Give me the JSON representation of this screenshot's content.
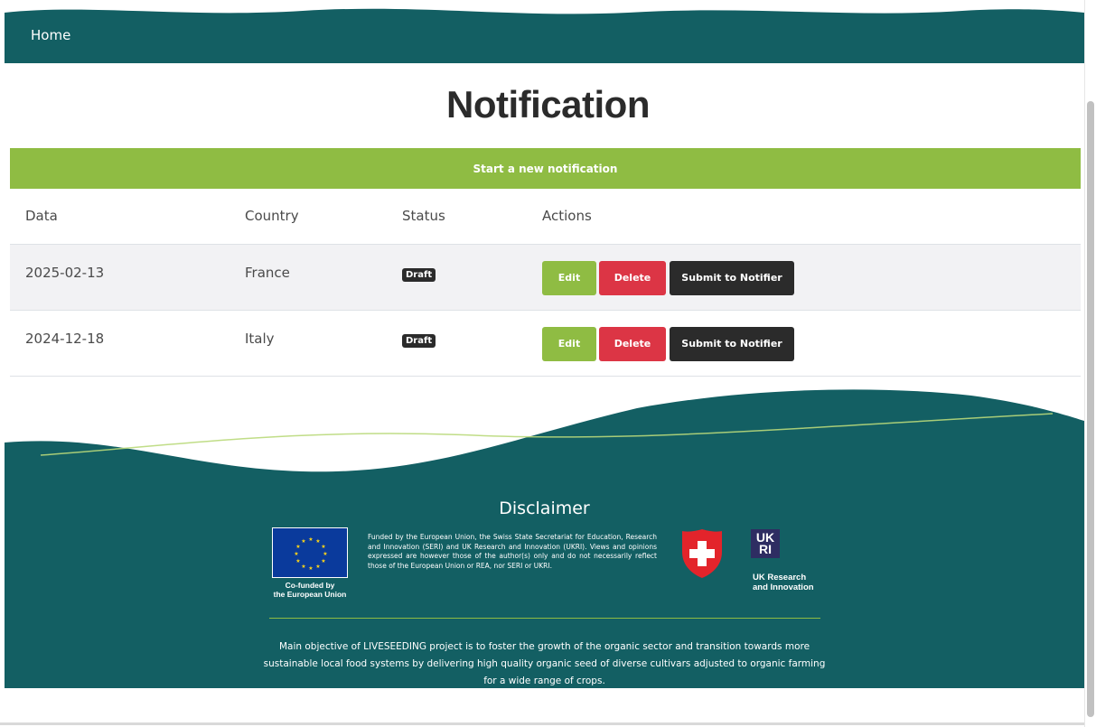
{
  "nav": {
    "home_label": "Home"
  },
  "page": {
    "title": "Notification"
  },
  "actions": {
    "new_notification_label": "Start a new notification"
  },
  "table": {
    "columns": [
      "Data",
      "Country",
      "Status",
      "Actions"
    ],
    "rows": [
      {
        "date": "2025-02-13",
        "country": "France",
        "status": "Draft",
        "edit_label": "Edit",
        "delete_label": "Delete",
        "submit_label": "Submit to Notifier"
      },
      {
        "date": "2024-12-18",
        "country": "Italy",
        "status": "Draft",
        "edit_label": "Edit",
        "delete_label": "Delete",
        "submit_label": "Submit to Notifier"
      }
    ]
  },
  "footer": {
    "disclaimer_title": "Disclaimer",
    "eu_caption_line1": "Co-funded by",
    "eu_caption_line2": "the European Union",
    "funded_text": "Funded by the European Union, the Swiss State Secretariat for Education, Research and Innovation (SERI) and UK Research and Innovation (UKRI). Views and opinions expressed are however those of the author(s) only and do not necessarily reflect those of the European Union or REA, nor SERI or UKRI.",
    "ukri_mark_line1": "UK",
    "ukri_mark_line2": "RI",
    "ukri_caption_line1": "UK Research",
    "ukri_caption_line2": "and Innovation",
    "main_objective": "Main objective of LIVESEEDING project is to foster the growth of the organic sector and transition towards more sustainable local food systems by delivering high quality organic seed of diverse cultivars adjusted to organic farming for a wide range of crops."
  },
  "colors": {
    "header_teal": "#135f63",
    "accent_green": "#8fbc43",
    "danger_red": "#dc3545",
    "dark_button": "#2b2b2b",
    "swiss_red": "#e3242b",
    "eu_blue": "#0a3a9c",
    "ukri_navy": "#2e2d62"
  }
}
